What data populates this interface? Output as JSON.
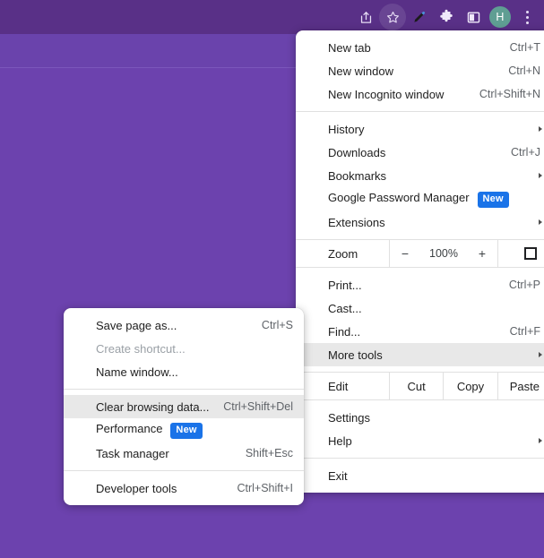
{
  "theme": {
    "toolbar_color": "#593087",
    "bookmarks_band_color": "#6a43ac",
    "page_color": "#6c42ae",
    "menu_bg": "#ffffff",
    "highlight_color": "#e8e8e8",
    "badge_color": "#1a73e8",
    "avatar_color": "#5f9e93",
    "accel_text_color": "#5f6368",
    "disabled_text_color": "#9aa0a6"
  },
  "toolbar": {
    "icons": [
      {
        "name": "share-icon",
        "glyph": "share"
      },
      {
        "name": "bookmark-star-icon",
        "glyph": "star"
      },
      {
        "name": "pen-highlighter-icon",
        "glyph": "pen"
      },
      {
        "name": "extensions-puzzle-icon",
        "glyph": "puzzle"
      },
      {
        "name": "side-panel-icon",
        "glyph": "panel"
      }
    ],
    "avatar_label": "H",
    "menu_button_name": "chrome-menu-button"
  },
  "main_menu": {
    "groups": [
      {
        "items": [
          {
            "label": "New tab",
            "accel": "Ctrl+T",
            "name": "menu-item-new-tab"
          },
          {
            "label": "New window",
            "accel": "Ctrl+N",
            "name": "menu-item-new-window"
          },
          {
            "label": "New Incognito window",
            "accel": "Ctrl+Shift+N",
            "name": "menu-item-new-incognito-window"
          }
        ]
      },
      {
        "items": [
          {
            "label": "History",
            "accel": "",
            "submenu": true,
            "name": "menu-item-history"
          },
          {
            "label": "Downloads",
            "accel": "Ctrl+J",
            "name": "menu-item-downloads"
          },
          {
            "label": "Bookmarks",
            "accel": "",
            "submenu": true,
            "name": "menu-item-bookmarks"
          },
          {
            "label": "Google Password Manager",
            "accel": "",
            "badge": "New",
            "name": "menu-item-google-password-manager"
          },
          {
            "label": "Extensions",
            "accel": "",
            "submenu": true,
            "name": "menu-item-extensions"
          }
        ]
      }
    ],
    "zoom_row": {
      "label": "Zoom",
      "minus": "−",
      "level": "100%",
      "plus": "+",
      "fullscreen_icon": "fullscreen-icon"
    },
    "group_print": [
      {
        "label": "Print...",
        "accel": "Ctrl+P",
        "name": "menu-item-print"
      },
      {
        "label": "Cast...",
        "accel": "",
        "name": "menu-item-cast"
      },
      {
        "label": "Find...",
        "accel": "Ctrl+F",
        "name": "menu-item-find"
      },
      {
        "label": "More tools",
        "accel": "",
        "submenu": true,
        "highlight": true,
        "name": "menu-item-more-tools"
      }
    ],
    "edit_row": {
      "label": "Edit",
      "actions": [
        {
          "label": "Cut",
          "name": "menu-item-cut"
        },
        {
          "label": "Copy",
          "name": "menu-item-copy"
        },
        {
          "label": "Paste",
          "name": "menu-item-paste"
        }
      ]
    },
    "group_settings": [
      {
        "label": "Settings",
        "accel": "",
        "name": "menu-item-settings"
      },
      {
        "label": "Help",
        "accel": "",
        "submenu": true,
        "name": "menu-item-help"
      }
    ],
    "group_exit": [
      {
        "label": "Exit",
        "accel": "",
        "name": "menu-item-exit"
      }
    ]
  },
  "sub_menu": {
    "group_one": [
      {
        "label": "Save page as...",
        "accel": "Ctrl+S",
        "name": "submenu-item-save-page-as"
      },
      {
        "label": "Create shortcut...",
        "accel": "",
        "disabled": true,
        "name": "submenu-item-create-shortcut"
      },
      {
        "label": "Name window...",
        "accel": "",
        "name": "submenu-item-name-window"
      }
    ],
    "group_two": [
      {
        "label": "Clear browsing data...",
        "accel": "Ctrl+Shift+Del",
        "highlight": true,
        "name": "submenu-item-clear-browsing-data"
      },
      {
        "label": "Performance",
        "accel": "",
        "badge": "New",
        "name": "submenu-item-performance"
      },
      {
        "label": "Task manager",
        "accel": "Shift+Esc",
        "name": "submenu-item-task-manager"
      }
    ],
    "group_three": [
      {
        "label": "Developer tools",
        "accel": "Ctrl+Shift+I",
        "name": "submenu-item-developer-tools"
      }
    ]
  }
}
